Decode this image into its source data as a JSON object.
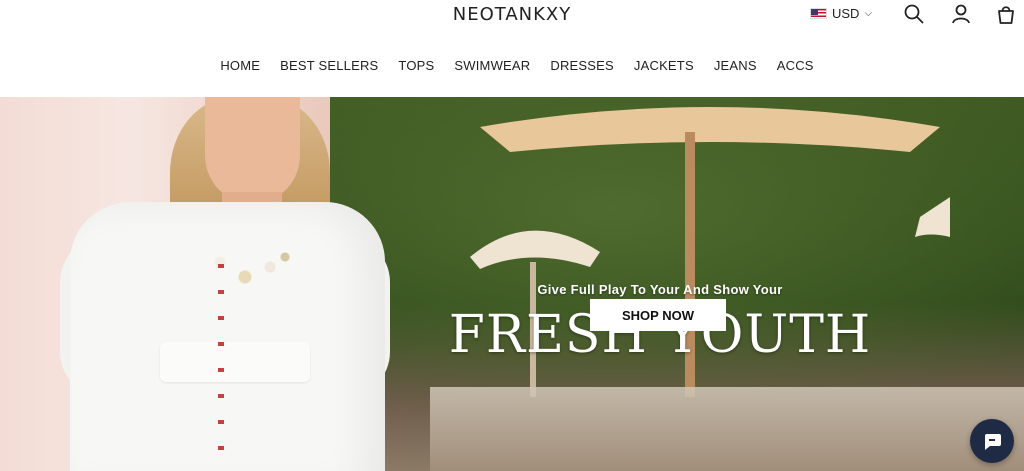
{
  "header": {
    "logo": "NEOTANKXY",
    "currency": "USD",
    "icons": [
      "search-icon",
      "account-icon",
      "cart-icon"
    ]
  },
  "nav": {
    "items": [
      "HOME",
      "BEST SELLERS",
      "TOPS",
      "SWIMWEAR",
      "DRESSES",
      "JACKETS",
      "JEANS",
      "ACCS"
    ]
  },
  "hero": {
    "subtitle": "Give Full Play To Your And Show Your",
    "title": "FRESH YOUTH",
    "cta": "SHOP NOW"
  },
  "chat": {
    "icon": "chat-icon"
  },
  "colors": {
    "chat_bg": "#1f2a44",
    "text": "#222222"
  }
}
